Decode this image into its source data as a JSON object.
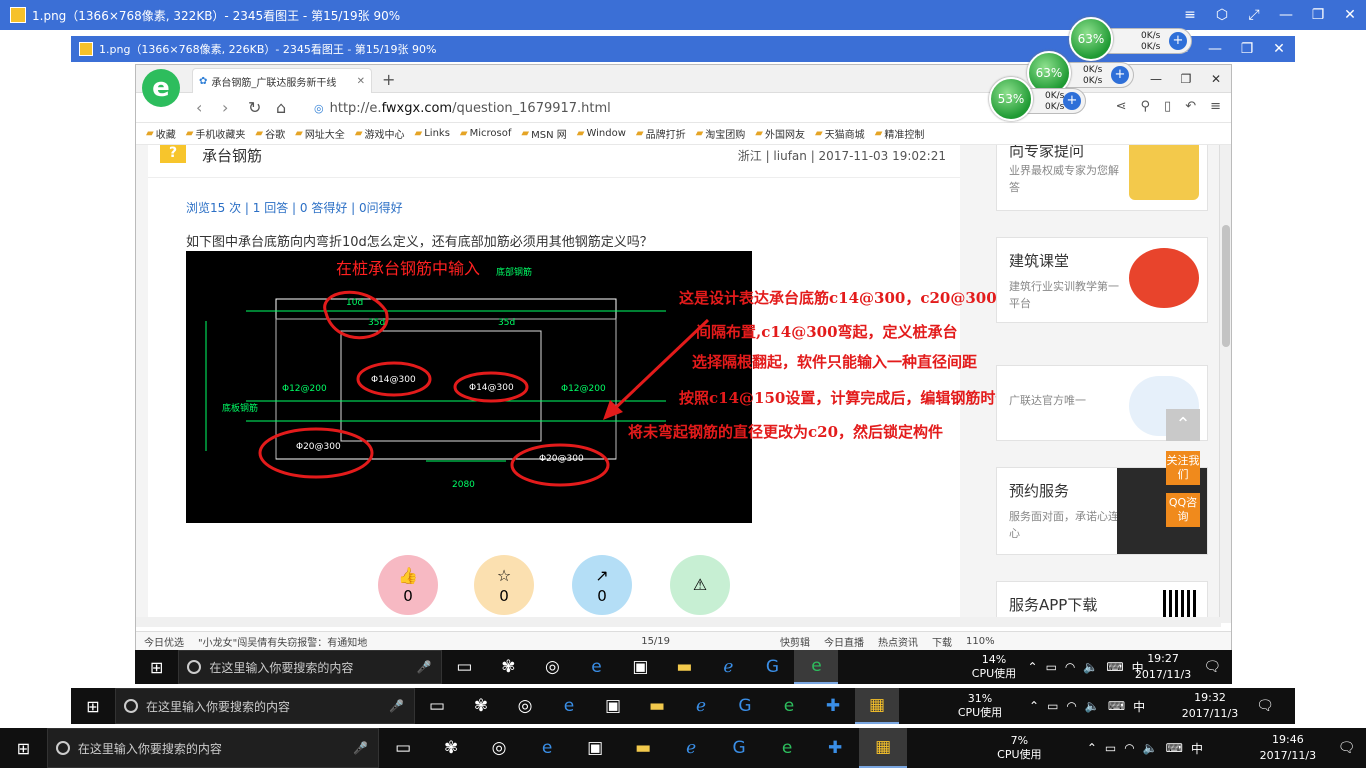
{
  "outer_window": {
    "title": "1.png（1366×768像素, 322KB）- 2345看图王 - 第15/19张 90%"
  },
  "inner_window": {
    "title": "1.png（1366×768像素, 226KB）- 2345看图王 - 第15/19张 90%"
  },
  "browser": {
    "tab_title": "承台钢筋_广联达服务新干线",
    "url_prefix": "http://e.",
    "url_host": "fwxgx.com",
    "url_path": "/question_1679917.html",
    "bookmarks": [
      "收藏",
      "手机收藏夹",
      "谷歌",
      "网址大全",
      "游戏中心",
      "Links",
      "Microsof",
      "MSN 网",
      "Window",
      "品牌打折",
      "淘宝团购",
      "外国网友",
      "天猫商城",
      "精准控制"
    ]
  },
  "question": {
    "title": "承台钢筋",
    "meta": "浙江 | liufan | 2017-11-03 19:02:21",
    "stats": "浏览15 次 | 1 回答 | 0 答得好 | 0问得好",
    "body": "如下图中承台底筋向内弯折10d怎么定义，还有底部加筋必须用其他钢筋定义吗？",
    "cad_caption": "在桩承台钢筋中输入",
    "cad_labels": [
      "10d",
      "35d",
      "35d",
      "底部钢筋",
      "Φ14@300",
      "Φ14@300",
      "Φ12@200",
      "Φ12@200",
      "Φ20@300",
      "Φ20@300",
      "底板钢筋",
      "2080"
    ],
    "annotations": [
      "这是设计表达承台底筋c14@300，c20@300",
      "间隔布置,c14@300弯起，定义桩承台",
      "选择隔根翻起，软件只能输入一种直径间距",
      "按照c14@150设置，计算完成后，编辑钢筋时候",
      "将未弯起钢筋的直径更改为c20，然后锁定构件"
    ],
    "actions": [
      {
        "icon": "thumb-up-icon",
        "count": "0",
        "color": "#f7b9c3"
      },
      {
        "icon": "star-icon",
        "count": "0",
        "color": "#fbe0b0"
      },
      {
        "icon": "share-icon",
        "count": "0",
        "color": "#b4def6"
      },
      {
        "icon": "warning-icon",
        "count": "",
        "color": "#c7efd3"
      }
    ]
  },
  "sidebar": {
    "cards": [
      {
        "title": "向专家提问",
        "desc": "业界最权威专家为您解答"
      },
      {
        "title": "建筑课堂",
        "desc": "建筑行业实训教学第一平台"
      },
      {
        "title": "",
        "desc": "广联达官方唯一"
      },
      {
        "title": "预约服务",
        "desc": "服务面对面，承诺心连心"
      },
      {
        "title": "服务APP下载",
        "desc": ""
      }
    ],
    "float_follow": "关注我们",
    "float_qq": "QQ咨询"
  },
  "statusbar": {
    "items": [
      "今日优选",
      "\"小龙女\"闯吴倩有失窃报警：有通知地",
      "15/19",
      "快剪辑",
      "今日直播",
      "热点资讯",
      "下载",
      "110%"
    ]
  },
  "taskbars": [
    {
      "search": "在这里输入你要搜索的内容",
      "cpu": "14%",
      "cpu_label": "CPU使用",
      "time": "19:27",
      "date": "2017/11/3",
      "notif": "3",
      "ime": "中"
    },
    {
      "search": "在这里输入你要搜索的内容",
      "cpu": "31%",
      "cpu_label": "CPU使用",
      "time": "19:32",
      "date": "2017/11/3",
      "notif": "3",
      "ime": "中"
    },
    {
      "search": "在这里输入你要搜索的内容",
      "cpu": "7%",
      "cpu_label": "CPU使用",
      "time": "19:46",
      "date": "2017/11/3",
      "notif": "3",
      "ime": "中"
    }
  ],
  "net_widgets": [
    {
      "percent": "63%",
      "up": "0K/s",
      "down": "0K/s"
    },
    {
      "percent": "63%",
      "up": "0K/s",
      "down": "0K/s"
    },
    {
      "percent": "53%",
      "up": "0K/s",
      "down": "0K/s"
    }
  ],
  "colors": {
    "titlebar": "#3b6fd6",
    "annotation_red": "#e31b1b",
    "taskbar": "#101010",
    "link_blue": "#2b6fc5"
  }
}
